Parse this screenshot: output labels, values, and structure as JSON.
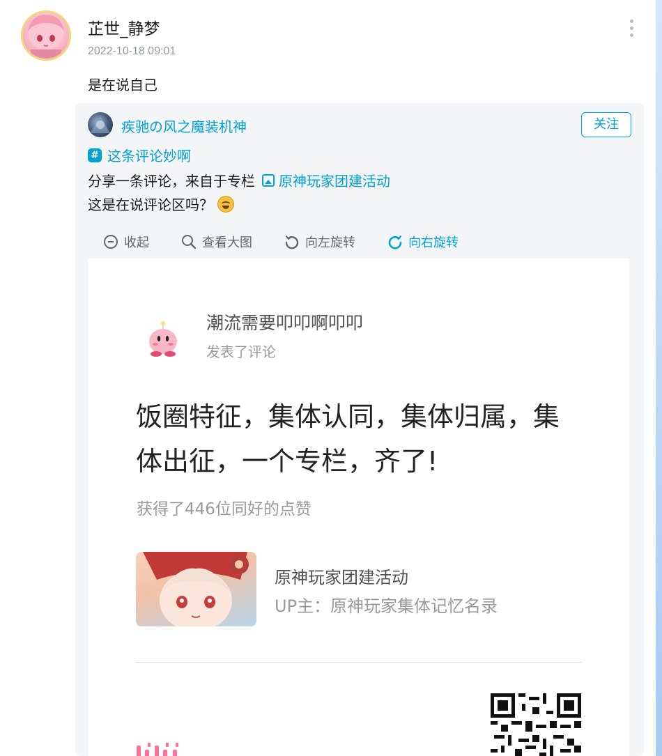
{
  "post": {
    "username": "芷世_静梦",
    "timestamp": "2022-10-18 09:01",
    "text": "是在说自己"
  },
  "shared": {
    "author": "疾驰の风之魔装机神",
    "follow_label": "关注",
    "topic": "这条评论妙啊",
    "share_prefix": "分享一条评论，来自于专栏",
    "article_link": "原神玩家团建活动",
    "quote_text": "这是在说评论区吗？"
  },
  "toolbar": {
    "collapse": "收起",
    "view_large": "查看大图",
    "rotate_left": "向左旋转",
    "rotate_right": "向右旋转"
  },
  "image": {
    "commenter": "潮流需要叩叩啊叩叩",
    "commented": "发表了评论",
    "comment_text": "饭圈特征，集体认同，集体归属，集体出征，一个专栏，齐了!",
    "likes": "获得了446位同好的点赞",
    "article_title": "原神玩家团建活动",
    "article_up": "UP主：原神玩家集体记忆名录"
  },
  "colors": {
    "accent": "#00a1d6",
    "card_bg": "#f4f5f7",
    "muted": "#9499a0"
  },
  "icons": [
    "more-icon",
    "hash-icon",
    "picture-icon",
    "emoji-icon",
    "collapse-icon",
    "magnifier-icon",
    "rotate-left-icon",
    "rotate-right-icon",
    "qr-code"
  ]
}
